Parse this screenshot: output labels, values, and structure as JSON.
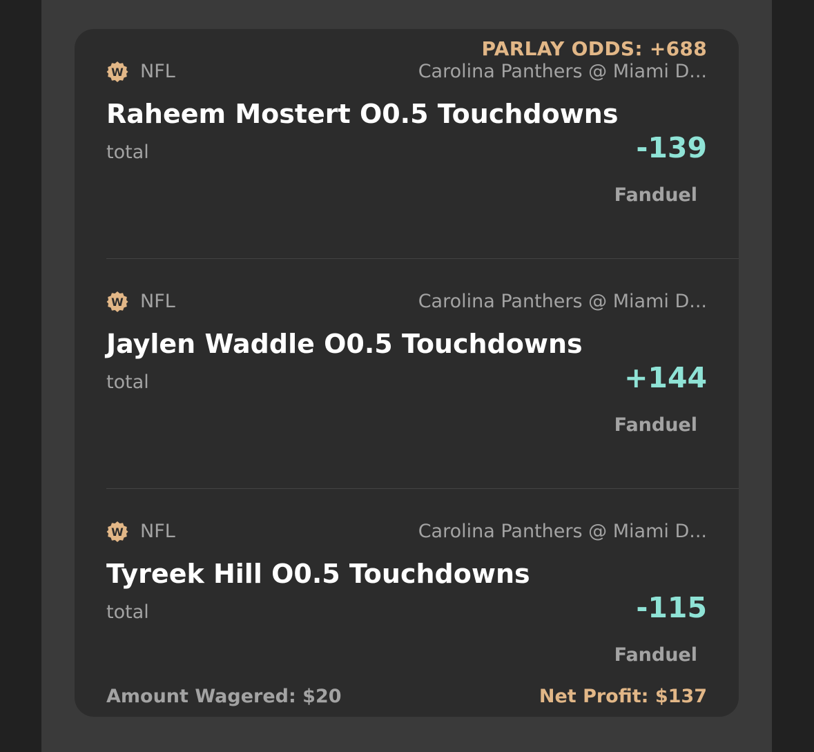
{
  "colors": {
    "background": "#212121",
    "panel": "#3a3a3a",
    "card": "#2c2c2c",
    "accent_gold": "#e2b787",
    "odds_teal": "#8fe3d6",
    "muted_text": "#a3a3a3",
    "primary_text": "#ffffff"
  },
  "parlay": {
    "odds_label": "PARLAY ODDS: +688"
  },
  "legs": [
    {
      "logo_icon": "w-badge-icon",
      "league": "NFL",
      "matchup": "Carolina Panthers @ Miami D...",
      "pick": "Raheem Mostert O0.5 Touchdowns",
      "market": "total",
      "odds": "-139",
      "book": "Fanduel"
    },
    {
      "logo_icon": "w-badge-icon",
      "league": "NFL",
      "matchup": "Carolina Panthers @ Miami D...",
      "pick": "Jaylen Waddle O0.5 Touchdowns",
      "market": "total",
      "odds": "+144",
      "book": "Fanduel"
    },
    {
      "logo_icon": "w-badge-icon",
      "league": "NFL",
      "matchup": "Carolina Panthers @ Miami D...",
      "pick": "Tyreek Hill O0.5 Touchdowns",
      "market": "total",
      "odds": "-115",
      "book": "Fanduel"
    }
  ],
  "footer": {
    "amount_wagered": "Amount Wagered: $20",
    "net_profit": "Net Profit: $137"
  }
}
